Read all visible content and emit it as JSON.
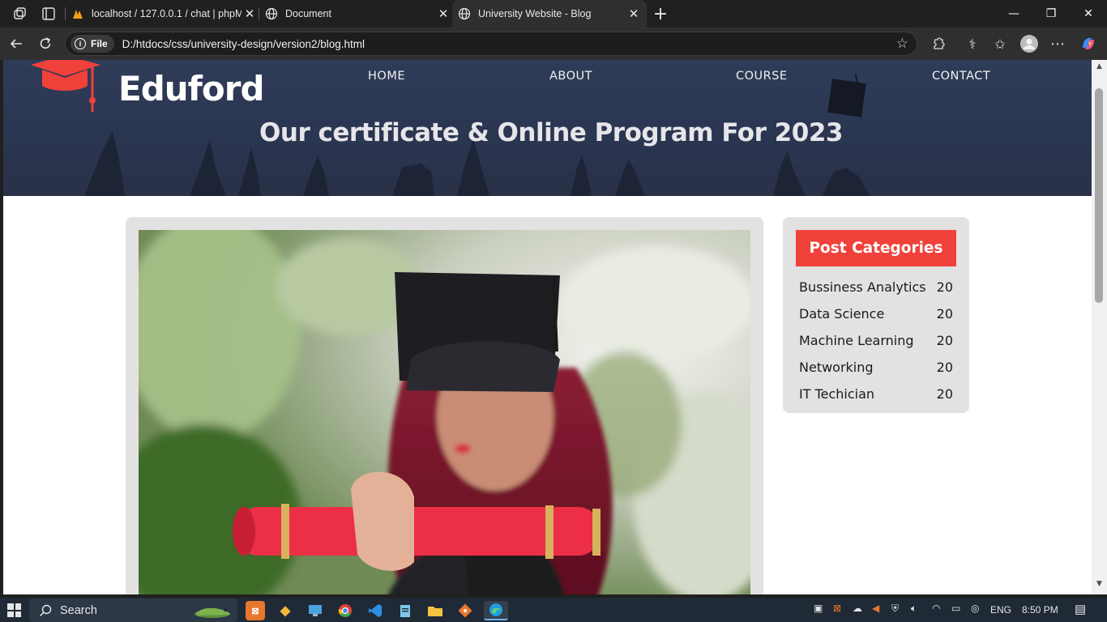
{
  "browser": {
    "tabs": [
      {
        "title": "localhost / 127.0.0.1 / chat | phpMyAdmin",
        "close": "✕"
      },
      {
        "title": "Document",
        "close": "✕"
      },
      {
        "title": "University Website - Blog",
        "close": "✕"
      }
    ],
    "new_tab": "+",
    "window_controls": {
      "minimize": "—",
      "restore": "❐",
      "close": "✕"
    },
    "address": {
      "scheme_label": "File",
      "url": "D:/htdocs/css/university-design/version2/blog.html"
    }
  },
  "site": {
    "logo_text": "Eduford",
    "nav": [
      "HOME",
      "ABOUT",
      "COURSE",
      "CONTACT"
    ],
    "hero_title": "Our certificate & Online Program For 2023",
    "categories": {
      "heading": "Post Categories",
      "items": [
        {
          "name": "Bussiness Analytics",
          "count": "20"
        },
        {
          "name": "Data Science",
          "count": "20"
        },
        {
          "name": "Machine Learning",
          "count": "20"
        },
        {
          "name": "Networking",
          "count": "20"
        },
        {
          "name": "IT Techician",
          "count": "20"
        }
      ]
    }
  },
  "taskbar": {
    "search_label": "Search",
    "language": "ENG",
    "time": "8:50 PM"
  },
  "colors": {
    "accent": "#f0413a",
    "hero_bg": "#2f3c58",
    "card_bg": "#e2e2e2"
  }
}
